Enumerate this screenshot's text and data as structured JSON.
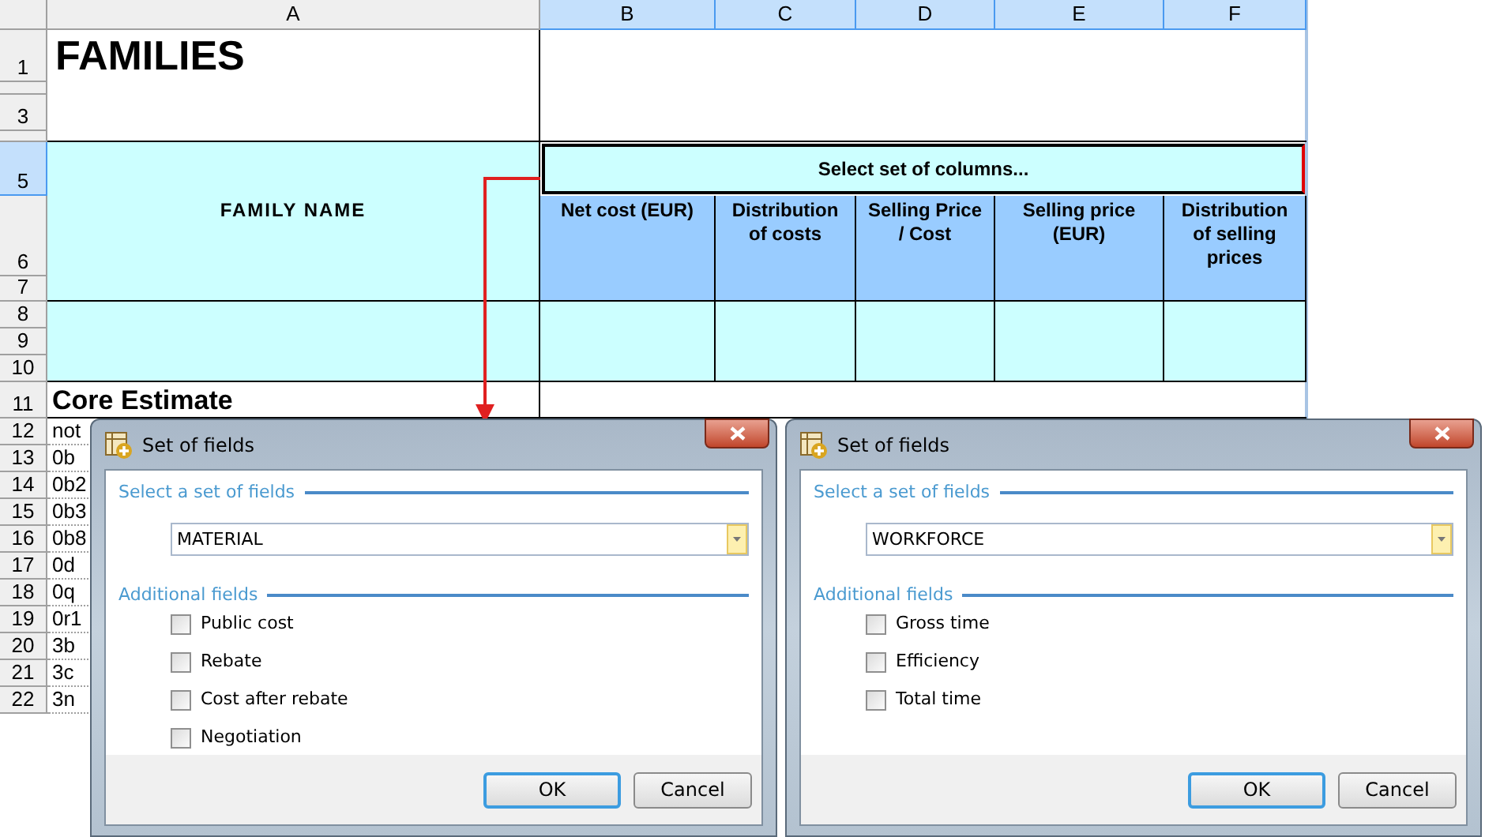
{
  "sheet": {
    "column_headers": [
      {
        "label": "A",
        "selected": false
      },
      {
        "label": "B",
        "selected": true
      },
      {
        "label": "C",
        "selected": true
      },
      {
        "label": "D",
        "selected": true
      },
      {
        "label": "E",
        "selected": true
      },
      {
        "label": "F",
        "selected": true
      }
    ],
    "row_headers": [
      {
        "label": "1",
        "selected": false
      },
      {
        "label": "3",
        "selected": false
      },
      {
        "label": "5",
        "selected": true
      },
      {
        "label": "6",
        "selected": false
      },
      {
        "label": "7",
        "selected": false
      },
      {
        "label": "8",
        "selected": false
      },
      {
        "label": "9",
        "selected": false
      },
      {
        "label": "10",
        "selected": false
      },
      {
        "label": "11",
        "selected": false
      },
      {
        "label": "12",
        "selected": false
      },
      {
        "label": "13",
        "selected": false
      },
      {
        "label": "14",
        "selected": false
      },
      {
        "label": "15",
        "selected": false
      },
      {
        "label": "16",
        "selected": false
      },
      {
        "label": "17",
        "selected": false
      },
      {
        "label": "18",
        "selected": false
      },
      {
        "label": "19",
        "selected": false
      },
      {
        "label": "20",
        "selected": false
      },
      {
        "label": "21",
        "selected": false
      },
      {
        "label": "22",
        "selected": false
      }
    ],
    "title": "FAMILIES",
    "family_name_header": "FAMILY NAME",
    "column_set_button": "Select set of columns...",
    "column_headings": [
      "Net cost (EUR)",
      "Distribution of costs",
      "Selling Price / Cost",
      "Selling price (EUR)",
      "Distribution of selling prices"
    ],
    "section_title": "Core Estimate",
    "column_a_values": [
      "not",
      "0b",
      "0b2",
      "0b3",
      "0b8",
      "0d",
      "0q",
      "0r1",
      "3b",
      "3c",
      "3n"
    ]
  },
  "dialogs": [
    {
      "title": "Set of fields",
      "set_label": "Select a set of fields",
      "selected_set": "MATERIAL",
      "additional_label": "Additional fields",
      "fields": [
        {
          "label": "Public cost",
          "checked": false
        },
        {
          "label": "Rebate",
          "checked": false
        },
        {
          "label": "Cost after rebate",
          "checked": false
        },
        {
          "label": "Negotiation",
          "checked": false
        }
      ],
      "buttons": [
        {
          "label": "OK",
          "default": true
        },
        {
          "label": "Cancel",
          "default": false
        }
      ]
    },
    {
      "title": "Set of fields",
      "set_label": "Select a set of fields",
      "selected_set": "WORKFORCE",
      "additional_label": "Additional fields",
      "fields": [
        {
          "label": "Gross time",
          "checked": false
        },
        {
          "label": "Efficiency",
          "checked": false
        },
        {
          "label": "Total time",
          "checked": false
        }
      ],
      "buttons": [
        {
          "label": "OK",
          "default": true
        },
        {
          "label": "Cancel",
          "default": false
        }
      ]
    }
  ]
}
